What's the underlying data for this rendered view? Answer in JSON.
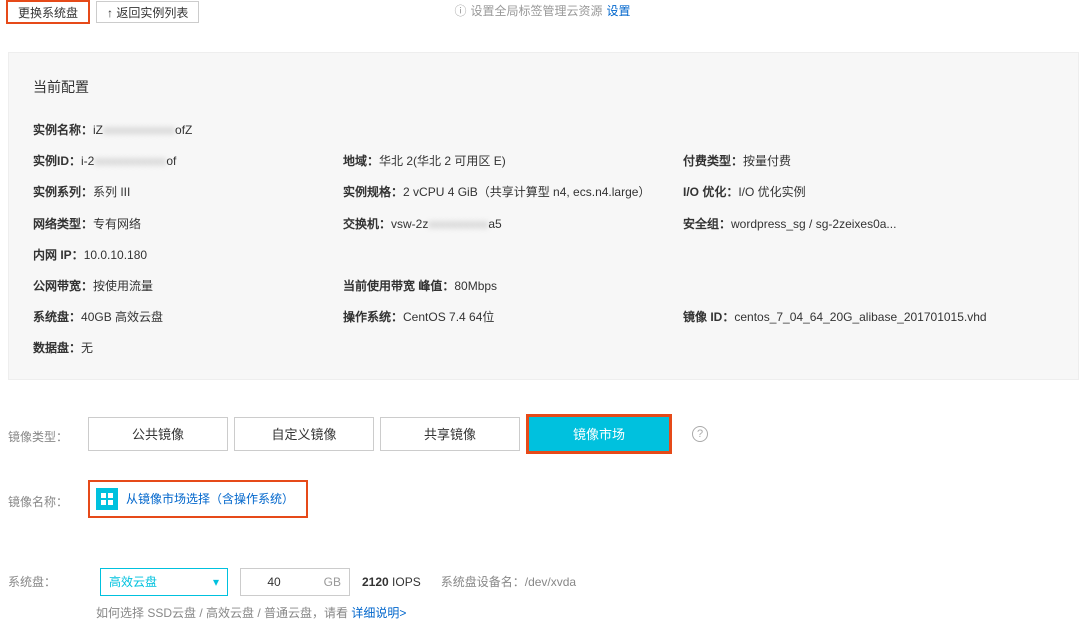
{
  "top": {
    "replace_disk_btn": "更换系统盘",
    "back_btn": "↑ 返回实例列表",
    "tag_hint_prefix": "设置全局标签管理云资源 ",
    "tag_link": "设置"
  },
  "panel": {
    "title": "当前配置",
    "items": {
      "instance_name_label": "实例名称：",
      "instance_name_value_prefix": "iZ",
      "instance_name_value_blur": "xxxxxxxxxxxx",
      "instance_name_value_suffix": "ofZ",
      "instance_id_label": "实例ID：",
      "instance_id_value_prefix": "i-2",
      "instance_id_value_blur": "xxxxxxxxxxxx",
      "instance_id_value_suffix": "of",
      "region_label": "地域：",
      "region_value": "华北 2(华北 2 可用区 E)",
      "billing_label": "付费类型：",
      "billing_value": "按量付费",
      "series_label": "实例系列：",
      "series_value": "系列 III",
      "spec_label": "实例规格：",
      "spec_value": "2 vCPU 4 GiB（共享计算型 n4, ecs.n4.large）",
      "io_label": "I/O 优化：",
      "io_value": "I/O 优化实例",
      "network_type_label": "网络类型：",
      "network_type_value": "专有网络",
      "vswitch_label": "交换机：",
      "vswitch_value_prefix": "vsw-2z",
      "vswitch_value_blur": "xxxxxxxxxx",
      "vswitch_value_suffix": "a5",
      "sg_label": "安全组：",
      "sg_value": "wordpress_sg / sg-2zeixes0a...",
      "intranet_label": "内网 IP：",
      "intranet_value": "10.0.10.180",
      "bandwidth_label": "公网带宽：",
      "bandwidth_value": "按使用流量",
      "current_bw_label": "当前使用带宽 峰值：",
      "current_bw_value": "80Mbps",
      "sysdisk_label": "系统盘：",
      "sysdisk_value": "40GB 高效云盘",
      "os_label": "操作系统：",
      "os_value": "CentOS 7.4 64位",
      "image_id_label": "镜像 ID：",
      "image_id_value": "centos_7_04_64_20G_alibase_201701015.vhd",
      "datadisk_label": "数据盘：",
      "datadisk_value": "无"
    }
  },
  "image_type": {
    "label": "镜像类型：",
    "options": [
      "公共镜像",
      "自定义镜像",
      "共享镜像",
      "镜像市场"
    ],
    "selected_index": 3
  },
  "image_name": {
    "label": "镜像名称：",
    "select_text": "从镜像市场选择（含操作系统）"
  },
  "sysdisk": {
    "label": "系统盘：",
    "disk_type": "高效云盘",
    "size": "40",
    "unit": "GB",
    "iops_value": "2120",
    "iops_label": " IOPS",
    "device_label": "系统盘设备名：",
    "device_value": "/dev/xvda",
    "hint_prefix": "如何选择 SSD云盘 / 高效云盘 / 普通云盘，请看 ",
    "hint_link": "详细说明>"
  }
}
